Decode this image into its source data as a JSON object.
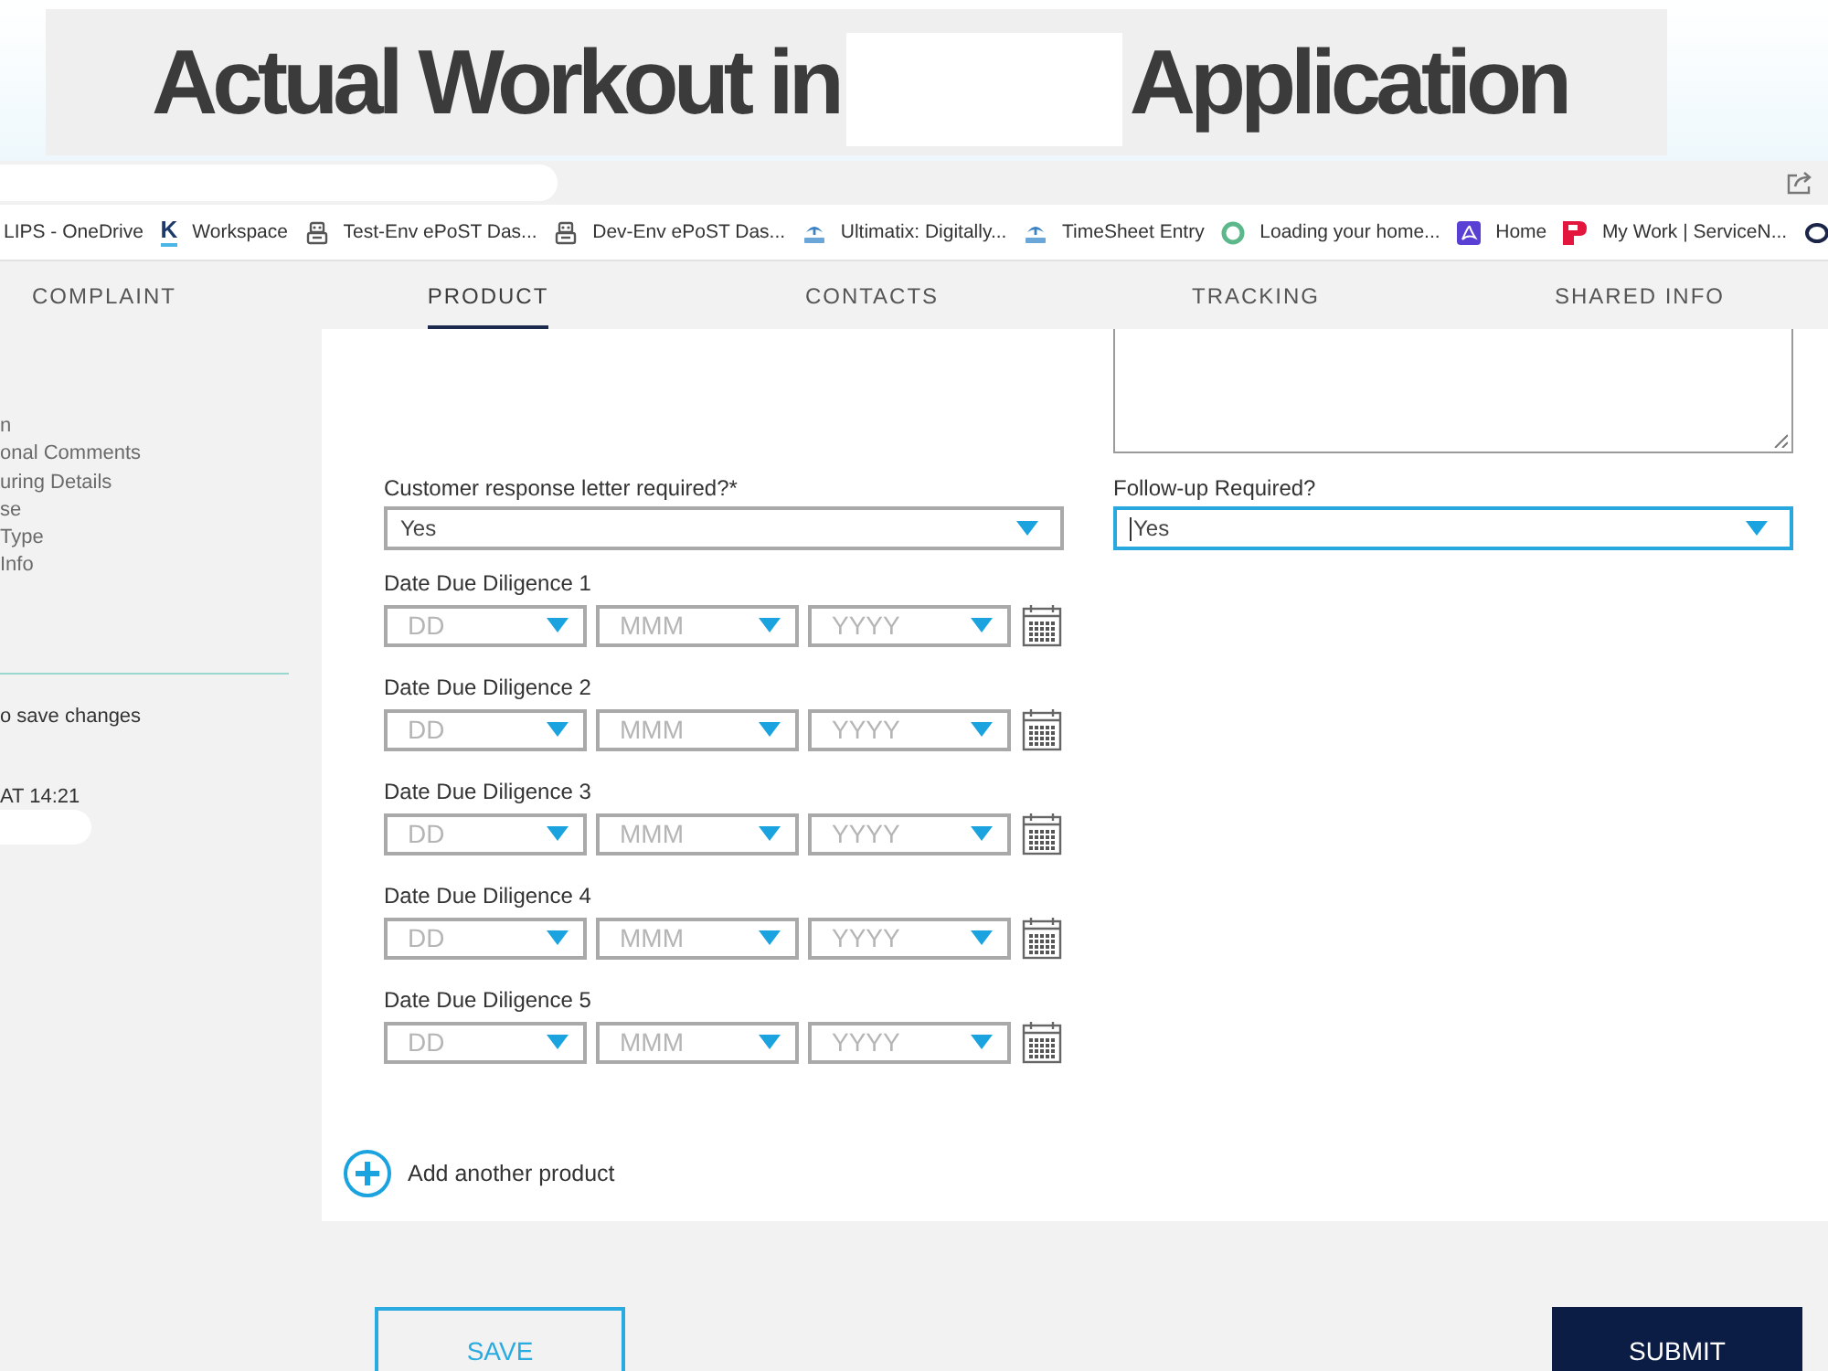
{
  "slide": {
    "title_start": "Actual Workout in",
    "title_end": "Application"
  },
  "bookmarks": [
    {
      "kind": "none",
      "label": "LIPS - OneDrive"
    },
    {
      "kind": "letter",
      "glyph": "K",
      "label": "Workspace"
    },
    {
      "kind": "robot",
      "label": "Test-Env ePoST Das..."
    },
    {
      "kind": "robot",
      "label": "Dev-Env ePoST Das..."
    },
    {
      "kind": "emblem",
      "label": "Ultimatix: Digitally..."
    },
    {
      "kind": "emblem",
      "label": "TimeSheet Entry"
    },
    {
      "kind": "ring",
      "label": "Loading your home..."
    },
    {
      "kind": "tile",
      "label": "Home"
    },
    {
      "kind": "badge",
      "label": "My Work | ServiceN..."
    },
    {
      "kind": "oval"
    }
  ],
  "tabs": [
    {
      "label": "COMPLAINT",
      "selected": false
    },
    {
      "label": "PRODUCT",
      "selected": true
    },
    {
      "label": "CONTACTS",
      "selected": false
    },
    {
      "label": "TRACKING",
      "selected": false
    },
    {
      "label": "SHARED INFO",
      "selected": false
    }
  ],
  "sidebar": {
    "items": [
      "n",
      "onal Comments",
      "uring Details",
      "se",
      "Type",
      "Info"
    ],
    "save_hint": "o save changes",
    "timestamp": "AT 14:21"
  },
  "form": {
    "selects": [
      {
        "label": "Customer response letter required?*",
        "value": "Yes",
        "focused": false
      },
      {
        "label": "Follow-up Required?",
        "value": "Yes",
        "focused": true
      }
    ],
    "date_fields": [
      {
        "label": "Date Due Diligence 1",
        "day": {
          "placeholder": "DD"
        },
        "month": {
          "placeholder": "MMM"
        },
        "year": {
          "placeholder": "YYYY"
        }
      },
      {
        "label": "Date Due Diligence 2",
        "day": {
          "placeholder": "DD"
        },
        "month": {
          "placeholder": "MMM"
        },
        "year": {
          "placeholder": "YYYY"
        }
      },
      {
        "label": "Date Due Diligence 3",
        "day": {
          "placeholder": "DD"
        },
        "month": {
          "placeholder": "MMM"
        },
        "year": {
          "placeholder": "YYYY"
        }
      },
      {
        "label": "Date Due Diligence 4",
        "day": {
          "placeholder": "DD"
        },
        "month": {
          "placeholder": "MMM"
        },
        "year": {
          "placeholder": "YYYY"
        }
      },
      {
        "label": "Date Due Diligence 5",
        "day": {
          "placeholder": "DD"
        },
        "month": {
          "placeholder": "MMM"
        },
        "year": {
          "placeholder": "YYYY"
        }
      }
    ],
    "add_link": "Add another product"
  },
  "buttons": [
    {
      "kind": "outline",
      "label": "SAVE"
    },
    {
      "kind": "filled",
      "label": "SUBMIT"
    }
  ]
}
